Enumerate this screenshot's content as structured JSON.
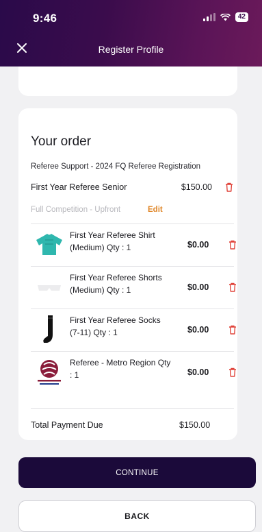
{
  "status_bar": {
    "time": "9:46",
    "battery": "42"
  },
  "header": {
    "title": "Register Profile",
    "close_icon": "close-icon"
  },
  "order": {
    "heading": "Your order",
    "registration": "Referee Support - 2024 FQ Referee Registration",
    "main_item": {
      "name": "First Year Referee Senior",
      "price": "$150.00"
    },
    "variant": "Full Competition - Upfront",
    "edit_label": "Edit",
    "items": [
      {
        "label": "First Year Referee Shirt (Medium) Qty : 1",
        "price": "$0.00",
        "icon": "shirt-icon"
      },
      {
        "label": "First Year Referee Shorts (Medium) Qty : 1",
        "price": "$0.00",
        "icon": "shorts-icon"
      },
      {
        "label": "First Year Referee Socks (7-11) Qty : 1",
        "price": "$0.00",
        "icon": "socks-icon"
      },
      {
        "label": "Referee - Metro Region Qty : 1",
        "price": "$0.00",
        "icon": "football-queensland-logo"
      }
    ],
    "total_label": "Total Payment Due",
    "total_value": "$150.00"
  },
  "actions": {
    "continue_label": "CONTINUE",
    "back_label": "BACK"
  },
  "colors": {
    "header_start": "#2a0a4a",
    "header_end": "#6b1a5a",
    "accent": "#e0882b",
    "trash": "#e0433a",
    "continue_bg": "#1b0a3a"
  }
}
